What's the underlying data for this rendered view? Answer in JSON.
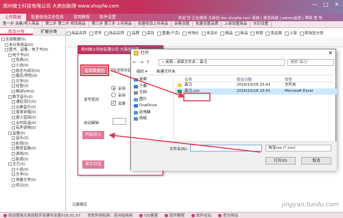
{
  "window": {
    "title": "郑州微士科技有限公司 大商创助理 www.shopfw.com",
    "controls": [
      "—",
      "□",
      "✕"
    ]
  },
  "menubar": {
    "items": [
      "上传数据",
      "批量修改店员信息",
      "常用教程",
      "软件设置"
    ],
    "active_index": 0,
    "right_text": "欢迎 您 正在使用 大商创 dsc.shopfw.com 商城 | 更改商城 | admin会员 | 帮助 登 导"
  },
  "toolbar": {
    "items": [
      "第一步 采集/导入商品",
      "第二步 第二步 修改商品",
      "第三步 第三步 上传商品",
      "批量修改上传商品",
      "采集设置",
      "批量设置品牌",
      "上架设置商品",
      "水印设置"
    ]
  },
  "sidebar": {
    "tabs": [
      "商品分类",
      "扩展分类"
    ],
    "active_tab": 0,
    "tree": [
      {
        "label": "全部数据(0)",
        "indent": 0
      },
      {
        "label": "未分类商品(0)",
        "indent": 1
      },
      {
        "label": "图书、音像、电子书(0)",
        "indent": 1
      },
      {
        "label": "电子书(0)",
        "indent": 2
      },
      {
        "label": "免费(0)",
        "indent": 3
      },
      {
        "label": "小说(0)",
        "indent": 3
      },
      {
        "label": "励志与成功(0)",
        "indent": 3
      },
      {
        "label": "婚恋/两性(0)",
        "indent": 3
      },
      {
        "label": "文学(0)",
        "indent": 3
      },
      {
        "label": "经管(0)",
        "indent": 3
      },
      {
        "label": "畅读VIP(0)",
        "indent": 3
      },
      {
        "label": "数字音乐(0)",
        "indent": 2
      },
      {
        "label": "通俗流行(0)",
        "indent": 3
      },
      {
        "label": "古典音乐(0)",
        "indent": 3
      },
      {
        "label": "摇滚说唱(0)",
        "indent": 3
      },
      {
        "label": "爵士蓝调(0)",
        "indent": 3
      },
      {
        "label": "乡村民谣(0)",
        "indent": 3
      },
      {
        "label": "有声读物(0)",
        "indent": 3
      },
      {
        "label": "音像(0)",
        "indent": 2
      },
      {
        "label": "音乐(0)",
        "indent": 3
      },
      {
        "label": "影视(0)",
        "indent": 3
      },
      {
        "label": "教育音像(0)",
        "indent": 3
      },
      {
        "label": "游戏(0)",
        "indent": 3
      },
      {
        "label": "影视(0)",
        "indent": 3
      },
      {
        "label": "文艺(0)",
        "indent": 2
      },
      {
        "label": "小说(0)",
        "indent": 3
      },
      {
        "label": "文学(0)",
        "indent": 3
      },
      {
        "label": "青春文学(0)",
        "indent": 3
      },
      {
        "label": "传记(0)",
        "indent": 3
      }
    ]
  },
  "main": {
    "filters": [
      "商品名称",
      "货号",
      "商品名称",
      "品牌",
      "库存",
      "重量(千克)",
      "市场价",
      "本店价",
      "精品",
      "新品",
      "热销",
      "免运费",
      "上架",
      "原淘宝分类"
    ],
    "footer_label": "元素路径"
  },
  "import_dialog": {
    "title": "郑州微士科技有限公司 大商创助理",
    "select_button": "选择数据包",
    "select_hint": "请先选择淘宝数据包",
    "label_type": "读号规则",
    "radio1": "采用",
    "radio2": "采用",
    "checkbox": "如果",
    "label_auto": "自动编辑",
    "start_button": "开始导入",
    "log_button": "显示日志"
  },
  "file_dialog": {
    "title": "打开",
    "path": "« 桌面 › 桌面文件夹 › 森马",
    "search_placeholder": "搜索\"森马\"",
    "commands": [
      "组织 ▾",
      "新建文件夹"
    ],
    "left_items": [
      {
        "label": "桌面",
        "icon": "desktop-icon"
      },
      {
        "label": "下载",
        "icon": "download-icon"
      },
      {
        "label": "文档",
        "icon": "document-icon"
      },
      {
        "label": "图片",
        "icon": "picture-icon"
      },
      {
        "label": "OneDrive",
        "icon": "cloud-icon"
      },
      {
        "label": "此电脑",
        "icon": "computer-icon"
      },
      {
        "label": "网络",
        "icon": "network-icon"
      }
    ],
    "columns": [
      "名称",
      "修改日期",
      "类型"
    ],
    "files": [
      {
        "name": "森马",
        "date": "2016/10/18 15:41",
        "type": "文件夹",
        "icon": "folder-icon",
        "selected": false
      },
      {
        "name": "森马.csv",
        "date": "2016/10/18 15:41",
        "type": "Microsoft Excel",
        "icon": "excel-icon",
        "selected": true
      }
    ],
    "filename_label": "文件名(N):",
    "filename_value": "",
    "filetype": "淘宝csv (*.csv)",
    "open_button": "打开(O)",
    "cancel_button": "取消"
  },
  "statusbar": {
    "items": [
      "欢迎使用大商创助手店铺专业版V16.01.07",
      "本软件授权商：苏州经纬网",
      "QQ客服",
      "软件教程",
      "软件论坛",
      "官方网站"
    ]
  },
  "watermark": "jingyan.baidu.com",
  "colors": {
    "brand": "#d8365a",
    "accent": "#e07a98",
    "highlight": "#e0344a"
  }
}
